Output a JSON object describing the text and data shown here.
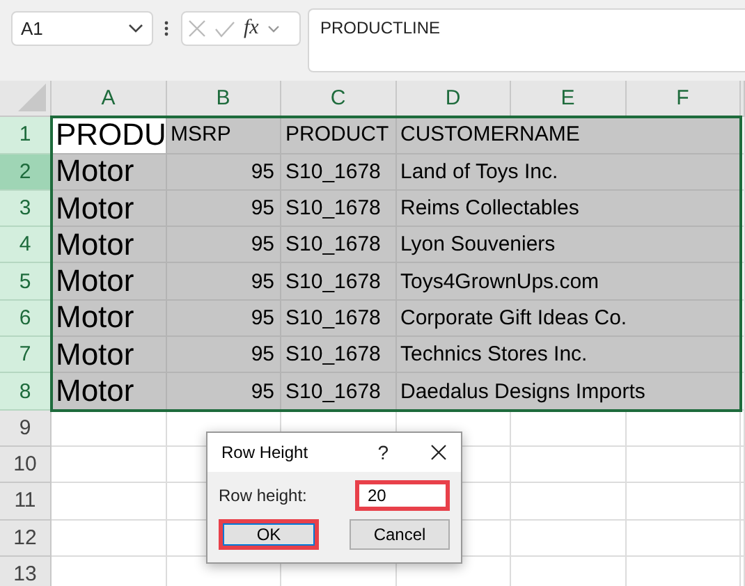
{
  "name_box": {
    "value": "A1"
  },
  "formula_bar": {
    "fx_label": "fx",
    "value": "PRODUCTLINE"
  },
  "columns": [
    {
      "label": "A"
    },
    {
      "label": "B"
    },
    {
      "label": "C"
    },
    {
      "label": "D"
    },
    {
      "label": "E"
    },
    {
      "label": "F"
    }
  ],
  "rows": [
    {
      "header": "1",
      "selected": true,
      "hovered": false,
      "cells": [
        {
          "text": "PRODU",
          "kind": "large",
          "active": true
        },
        {
          "text": "MSRP",
          "kind": "text",
          "active": false
        },
        {
          "text": "PRODUCT",
          "kind": "text",
          "active": false
        },
        {
          "text": "CUSTOMERNAME",
          "kind": "text",
          "active": false
        }
      ]
    },
    {
      "header": "2",
      "selected": true,
      "hovered": true,
      "cells": [
        {
          "text": "Motor",
          "kind": "large",
          "active": false
        },
        {
          "text": "95",
          "kind": "number",
          "active": false
        },
        {
          "text": "S10_1678",
          "kind": "text",
          "active": false
        },
        {
          "text": "Land of Toys Inc.",
          "kind": "text",
          "active": false
        }
      ]
    },
    {
      "header": "3",
      "selected": true,
      "hovered": false,
      "cells": [
        {
          "text": "Motor",
          "kind": "large",
          "active": false
        },
        {
          "text": "95",
          "kind": "number",
          "active": false
        },
        {
          "text": "S10_1678",
          "kind": "text",
          "active": false
        },
        {
          "text": "Reims Collectables",
          "kind": "text",
          "active": false
        }
      ]
    },
    {
      "header": "4",
      "selected": true,
      "hovered": false,
      "cells": [
        {
          "text": "Motor",
          "kind": "large",
          "active": false
        },
        {
          "text": "95",
          "kind": "number",
          "active": false
        },
        {
          "text": "S10_1678",
          "kind": "text",
          "active": false
        },
        {
          "text": "Lyon Souveniers",
          "kind": "text",
          "active": false
        }
      ]
    },
    {
      "header": "5",
      "selected": true,
      "hovered": false,
      "cells": [
        {
          "text": "Motor",
          "kind": "large",
          "active": false
        },
        {
          "text": "95",
          "kind": "number",
          "active": false
        },
        {
          "text": "S10_1678",
          "kind": "text",
          "active": false
        },
        {
          "text": "Toys4GrownUps.com",
          "kind": "text",
          "active": false
        }
      ]
    },
    {
      "header": "6",
      "selected": true,
      "hovered": false,
      "cells": [
        {
          "text": "Motor",
          "kind": "large",
          "active": false
        },
        {
          "text": "95",
          "kind": "number",
          "active": false
        },
        {
          "text": "S10_1678",
          "kind": "text",
          "active": false
        },
        {
          "text": "Corporate Gift Ideas Co.",
          "kind": "text",
          "active": false
        }
      ]
    },
    {
      "header": "7",
      "selected": true,
      "hovered": false,
      "cells": [
        {
          "text": "Motor",
          "kind": "large",
          "active": false
        },
        {
          "text": "95",
          "kind": "number",
          "active": false
        },
        {
          "text": "S10_1678",
          "kind": "text",
          "active": false
        },
        {
          "text": "Technics Stores Inc.",
          "kind": "text",
          "active": false
        }
      ]
    },
    {
      "header": "8",
      "selected": true,
      "hovered": false,
      "cells": [
        {
          "text": "Motor",
          "kind": "large",
          "active": false
        },
        {
          "text": "95",
          "kind": "number",
          "active": false
        },
        {
          "text": "S10_1678",
          "kind": "text",
          "active": false
        },
        {
          "text": "Daedalus Designs Imports",
          "kind": "text",
          "active": false
        }
      ]
    },
    {
      "header": "9",
      "selected": false,
      "hovered": false
    },
    {
      "header": "10",
      "selected": false,
      "hovered": false
    },
    {
      "header": "11",
      "selected": false,
      "hovered": false
    },
    {
      "header": "12",
      "selected": false,
      "hovered": false
    },
    {
      "header": "13",
      "selected": false,
      "hovered": false
    }
  ],
  "dialog": {
    "title": "Row Height",
    "help": "?",
    "field_label": "Row height:",
    "field_value": "20",
    "field_highlighted": true,
    "buttons": [
      {
        "label": "OK",
        "default": true,
        "highlighted": true
      },
      {
        "label": "Cancel",
        "default": false,
        "highlighted": false
      }
    ]
  }
}
